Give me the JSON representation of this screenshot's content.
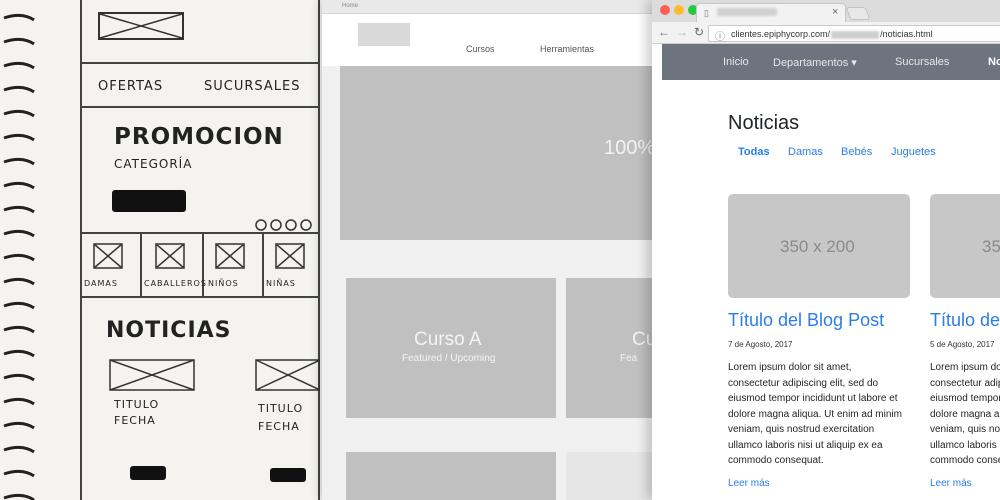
{
  "sketch": {
    "nav": [
      "Ofertas",
      "Sucursales"
    ],
    "promo_title": "Promocion",
    "promo_category": "Categoría",
    "categories": [
      "Damas",
      "Caballeros",
      "Niños",
      "Niñas"
    ],
    "news_title": "Noticias",
    "card_titles": [
      "Titulo",
      "Titulo"
    ],
    "card_dates": [
      "Fecha",
      "Fecha"
    ]
  },
  "wireframe": {
    "breadcrumb": "Home",
    "nav": [
      "Cursos",
      "Herramientas"
    ],
    "hero_text": "100%",
    "cards": [
      {
        "title": "Curso A",
        "subtitle": "Featured / Upcoming"
      },
      {
        "title": "Cu",
        "subtitle": "Fea"
      }
    ]
  },
  "browser": {
    "window_dots": [
      "#ff5f57",
      "#febc2e",
      "#28c840"
    ],
    "tab": {
      "icon": "page-icon",
      "close": "×"
    },
    "toolbar": {
      "back": "←",
      "forward": "→",
      "reload": "↻"
    },
    "url": {
      "prefix": "clientes.epiphycorp.com/",
      "suffix": "/noticias.html"
    },
    "navbar": {
      "items": [
        "Inicio",
        "Departamentos ▾",
        "Sucursales",
        "No"
      ],
      "color": "#6c757d"
    },
    "page": {
      "title": "Noticias",
      "filters": [
        "Todas",
        "Damas",
        "Bebés",
        "Juguetes"
      ],
      "accent": "#2b7de9",
      "posts": [
        {
          "image_text": "350 x 200",
          "title": "Título del Blog Post",
          "date": "7 de Agosto, 2017",
          "body": "Lorem ipsum dolor sit amet, consectetur adipiscing elit, sed do eiusmod tempor incididunt ut labore et dolore magna aliqua. Ut enim ad minim veniam, quis nostrud exercitation ullamco laboris nisi ut aliquip ex ea commodo consequat.",
          "more": "Leer más"
        },
        {
          "image_text": "35",
          "title": "Título del",
          "date": "5 de Agosto, 2017",
          "body": "Lorem ipsum dolor sit amet, consectetur adipiscing elit, sed do eiusmod tempor incididunt ut labore et dolore magna aliqua. Ut enim ad minim veniam, quis nostrud exercitation ullamco laboris nisi ut aliquip ex ea commodo consequat.",
          "more": "Leer más"
        }
      ]
    }
  }
}
